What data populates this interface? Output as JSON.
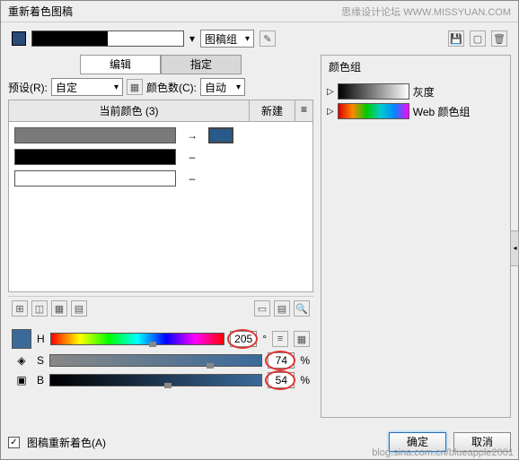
{
  "window": {
    "title": "重新着色图稿"
  },
  "watermark_top": "思缘设计论坛  WWW.MISSYUAN.COM",
  "watermark_bottom": "blog.sina.com.cn/blueapple2001",
  "topbar": {
    "combo_label": "图稿组",
    "icons": {
      "edit": "✎",
      "save": "💾",
      "new": "▢",
      "trash": "🗑"
    }
  },
  "tabs": {
    "edit": "编辑",
    "assign": "指定"
  },
  "preset": {
    "label": "预设(R):",
    "value": "自定",
    "colorcount_label": "颜色数(C):",
    "colorcount_value": "自动"
  },
  "colorlist": {
    "header_current": "当前颜色 (3)",
    "header_new": "新建",
    "header_menu": "≡",
    "rows": [
      {
        "color": "#7a7a7a",
        "arrow": "→",
        "new_color": "#2a5a8a"
      },
      {
        "color": "#000000",
        "arrow": "–",
        "new_color": "transparent"
      },
      {
        "color": "#ffffff",
        "arrow": "–",
        "new_color": "transparent"
      }
    ]
  },
  "toolbar": {
    "i1": "⊞",
    "i2": "◫",
    "i3": "▦",
    "i4": "▤",
    "e1": "▭",
    "e2": "▤",
    "e3": "🔍"
  },
  "hsb": {
    "swatch_color": "#3a6a9a",
    "h": {
      "label": "H",
      "value": "205",
      "unit": "°"
    },
    "s": {
      "label": "S",
      "value": "74",
      "unit": "%"
    },
    "b": {
      "label": "B",
      "value": "54",
      "unit": "%"
    },
    "side1": "≡",
    "side2": "▦"
  },
  "rightpane": {
    "title": "颜色组",
    "items": [
      {
        "label": "灰度"
      },
      {
        "label": "Web 颜色组"
      }
    ]
  },
  "footer": {
    "recolor_label": "图稿重新着色(A)",
    "ok": "确定",
    "cancel": "取消"
  }
}
